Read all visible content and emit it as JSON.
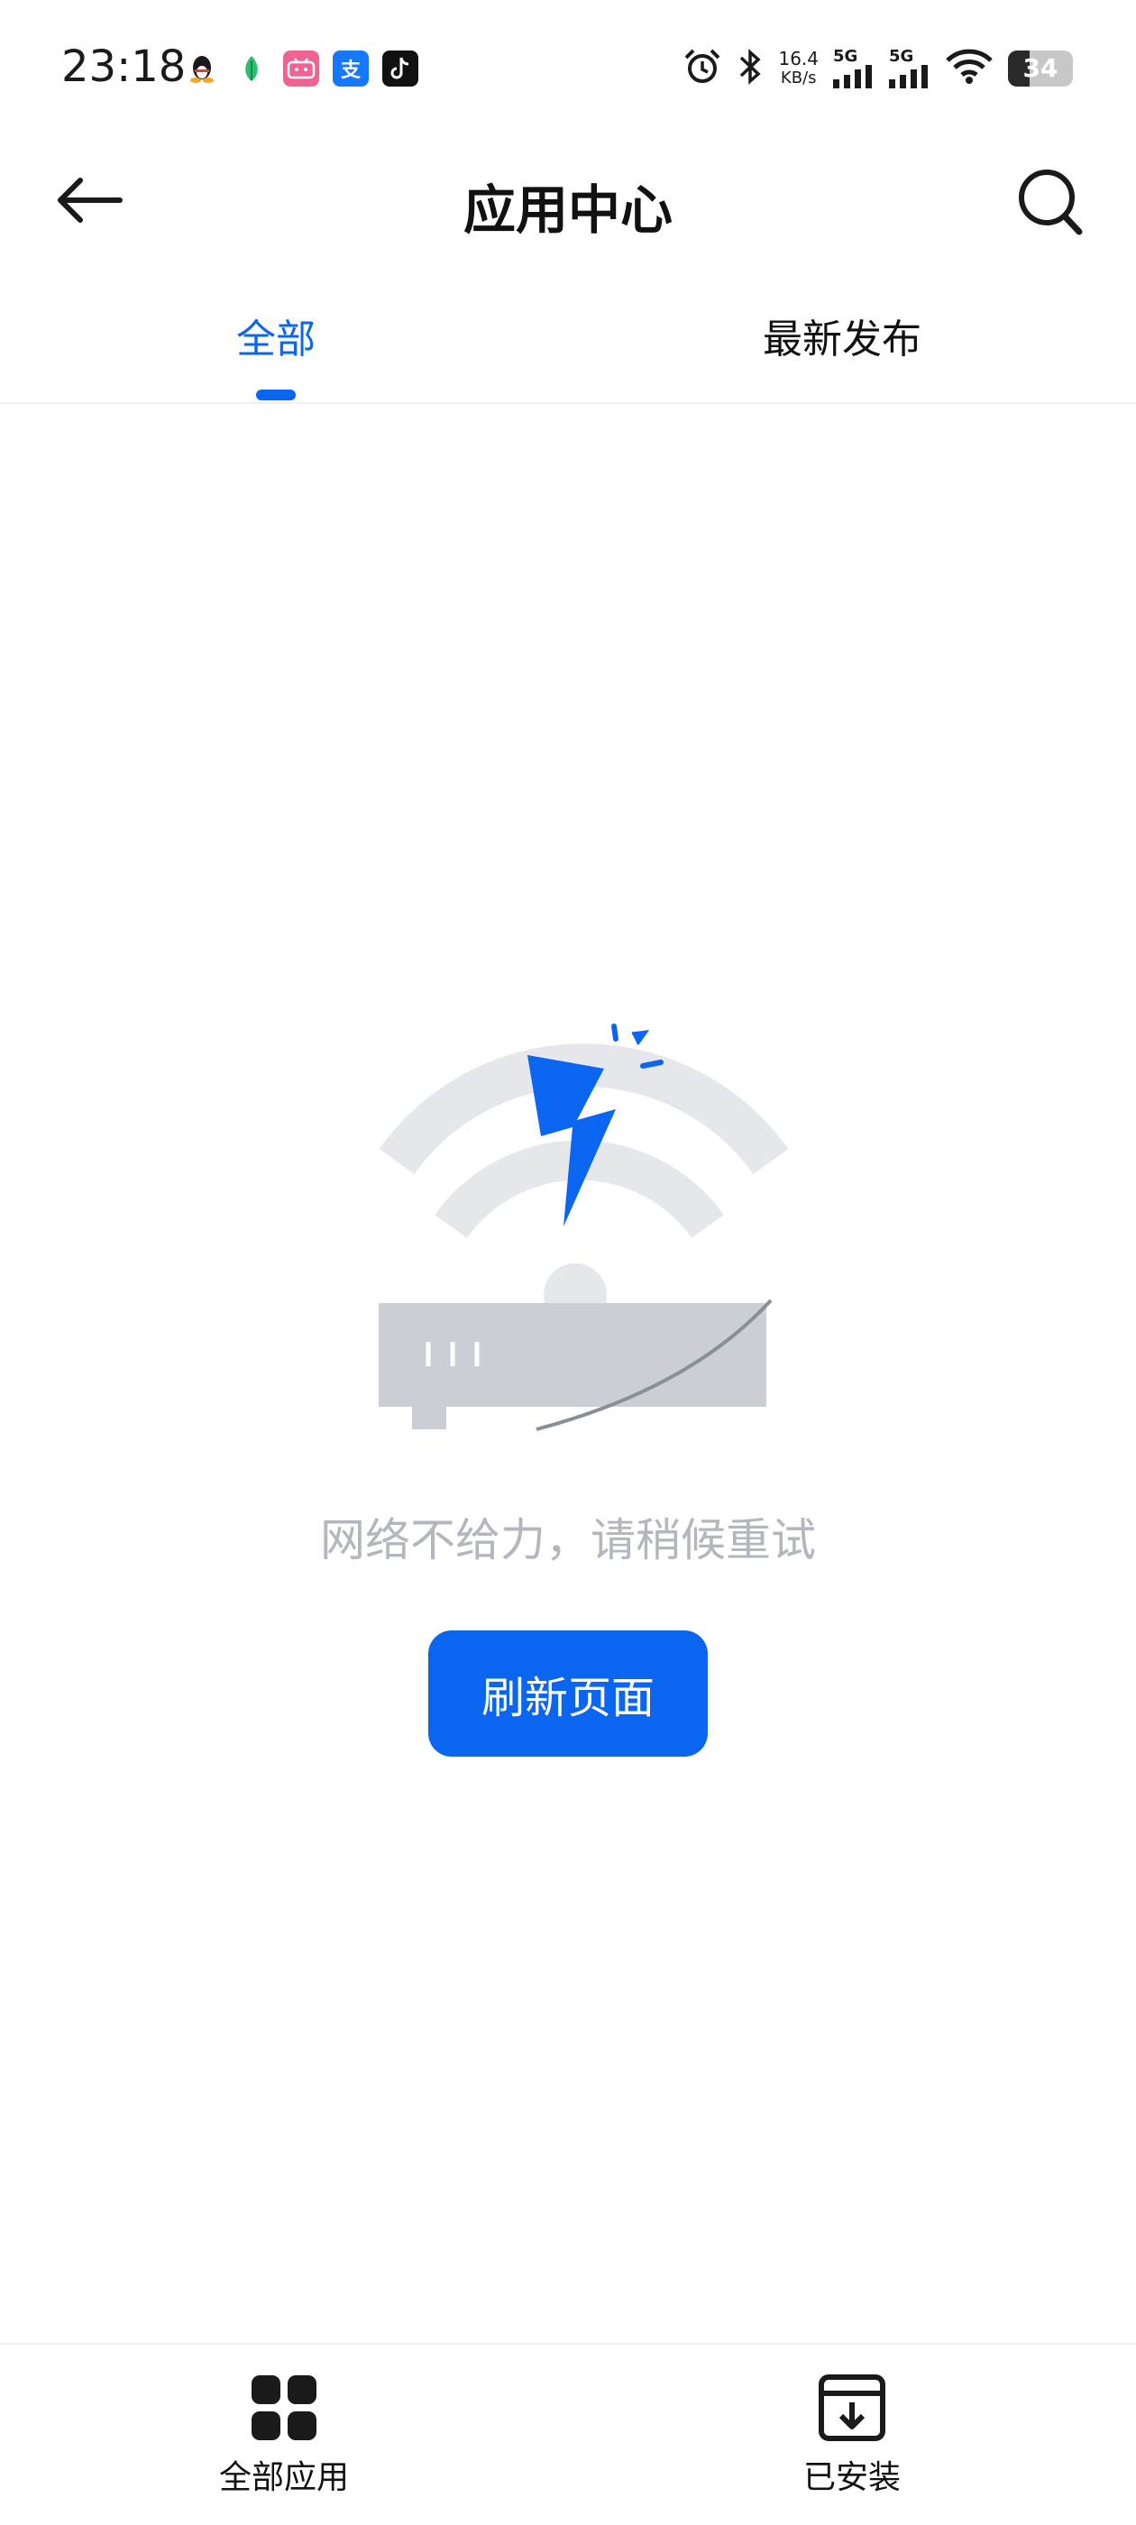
{
  "status_bar": {
    "time": "23:18",
    "net_speed_value": "16.4",
    "net_speed_unit": "KB/s",
    "signal1_label": "5G",
    "signal2_label": "5G",
    "battery_level": "34",
    "notification_icons": [
      "qq-icon",
      "leaf-app-icon",
      "bilibili-icon",
      "alipay-icon",
      "tiktok-icon"
    ],
    "alipay_glyph": "支"
  },
  "header": {
    "title": "应用中心"
  },
  "tabs": [
    {
      "label": "全部",
      "active": true
    },
    {
      "label": "最新发布",
      "active": false
    }
  ],
  "empty_state": {
    "message": "网络不给力，请稍候重试",
    "refresh_label": "刷新页面"
  },
  "bottom_nav": [
    {
      "label": "全部应用",
      "icon": "grid-icon"
    },
    {
      "label": "已安装",
      "icon": "download-box-icon"
    }
  ],
  "colors": {
    "accent": "#0a66f0",
    "muted_text": "#b3b6bd",
    "illustration_gray": "#e6e7eb",
    "router_gray": "#cbced4"
  }
}
